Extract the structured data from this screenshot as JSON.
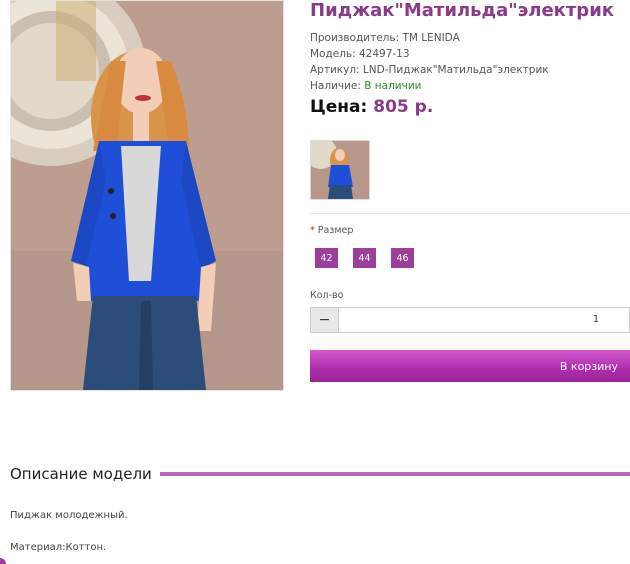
{
  "product": {
    "title": "Пиджак\"Матильда\"электрик",
    "manufacturer": "Производитель: TM LENIDA",
    "model": "Модель: 42497-13",
    "sku": "Артикул: LND-Пиджак\"Матильда\"электрик",
    "availability_label": "Наличие: ",
    "availability_value": "В наличии",
    "price_label": "Цена:",
    "price_value": "805 р."
  },
  "options": {
    "size_label": "Размер",
    "required_mark": "*",
    "sizes": [
      "42",
      "44",
      "46"
    ]
  },
  "quantity": {
    "label": "Кол-во",
    "minus": "−",
    "value": "1"
  },
  "cart": {
    "button_label": "В корзину"
  },
  "description": {
    "heading": "Описание модели",
    "lines": [
      "Пиджак молодежный.",
      "Материал:Коттон."
    ]
  },
  "colors": {
    "accent": "#9b3f9b",
    "title": "#8a3a8a",
    "in_stock": "#2f8a2f"
  }
}
